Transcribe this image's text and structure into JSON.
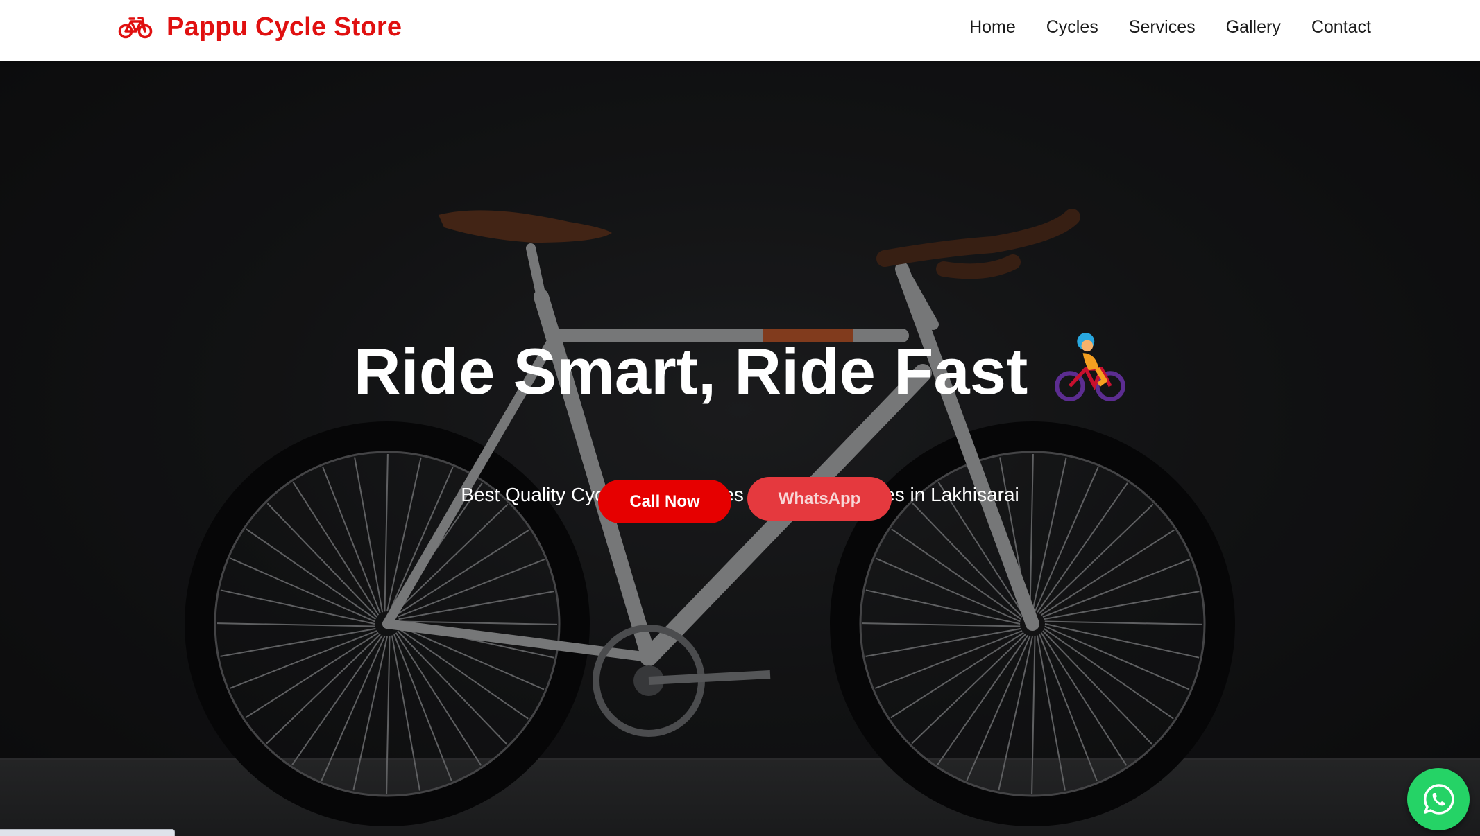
{
  "header": {
    "brand_name": "Pappu Cycle Store",
    "brand_icon": "bicycle-icon",
    "brand_color": "#e01010",
    "nav": [
      {
        "label": "Home"
      },
      {
        "label": "Cycles"
      },
      {
        "label": "Services"
      },
      {
        "label": "Gallery"
      },
      {
        "label": "Contact"
      }
    ]
  },
  "hero": {
    "title": "Ride Smart, Ride Fast",
    "title_icon": "cyclist-emoji",
    "subtitle": "Best Quality Cycles, Accessories & Repair Services in Lakhisarai",
    "call_button": "Call Now",
    "whatsapp_button": "WhatsApp",
    "call_button_color": "#e60000",
    "whatsapp_button_color": "#e5393e"
  },
  "floating": {
    "whatsapp_icon": "whatsapp-icon",
    "color": "#25d366"
  }
}
